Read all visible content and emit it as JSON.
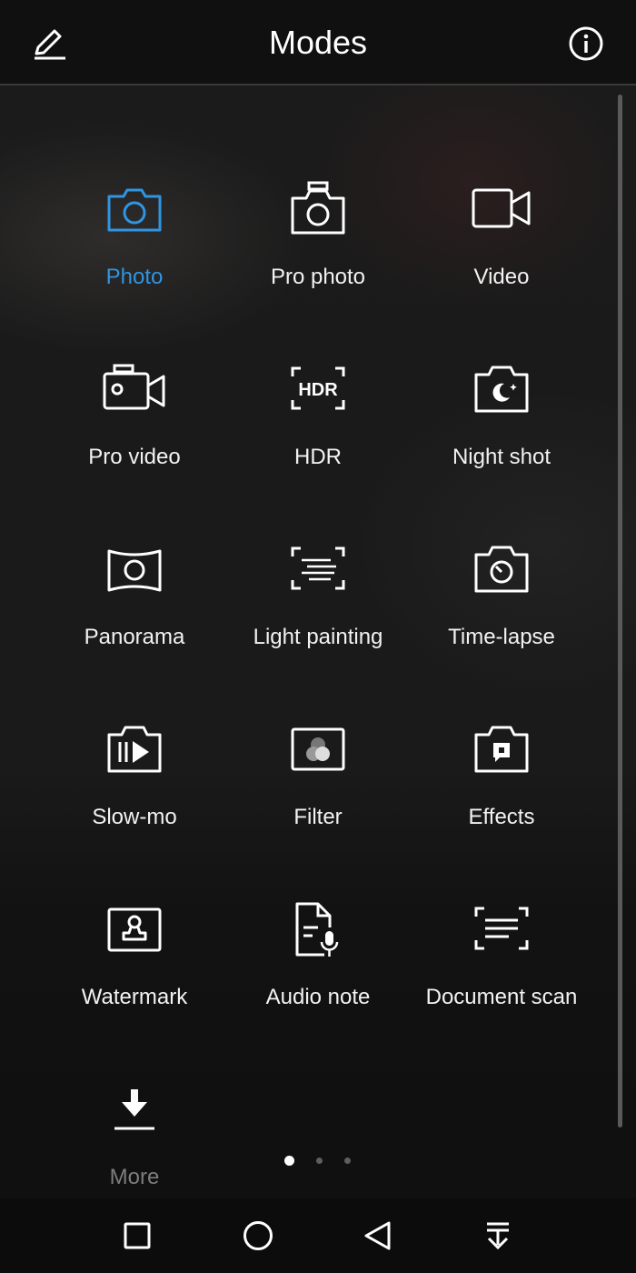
{
  "header": {
    "title": "Modes",
    "edit_icon": "pencil-edit-icon",
    "info_icon": "info-icon"
  },
  "modes": [
    {
      "label": "Photo",
      "icon": "camera-icon",
      "active": true
    },
    {
      "label": "Pro photo",
      "icon": "pro-camera-icon"
    },
    {
      "label": "Video",
      "icon": "video-camera-icon"
    },
    {
      "label": "Pro video",
      "icon": "pro-video-icon"
    },
    {
      "label": "HDR",
      "icon": "hdr-icon"
    },
    {
      "label": "Night shot",
      "icon": "night-camera-icon"
    },
    {
      "label": "Panorama",
      "icon": "panorama-icon"
    },
    {
      "label": "Light painting",
      "icon": "light-painting-icon"
    },
    {
      "label": "Time-lapse",
      "icon": "time-lapse-icon"
    },
    {
      "label": "Slow-mo",
      "icon": "slow-mo-icon"
    },
    {
      "label": "Filter",
      "icon": "filter-icon"
    },
    {
      "label": "Effects",
      "icon": "effects-icon"
    },
    {
      "label": "Watermark",
      "icon": "watermark-icon"
    },
    {
      "label": "Audio note",
      "icon": "audio-note-icon"
    },
    {
      "label": "Document scan",
      "icon": "document-scan-icon"
    },
    {
      "label": "More",
      "icon": "download-icon"
    }
  ],
  "pagination": {
    "pages": 3,
    "current": 1
  },
  "navbar": [
    "recents-square-icon",
    "home-circle-icon",
    "back-triangle-icon",
    "notification-pull-down-icon"
  ],
  "colors": {
    "accent": "#2f95e2",
    "text": "#ffffff",
    "muted": "#7d7d7d"
  }
}
